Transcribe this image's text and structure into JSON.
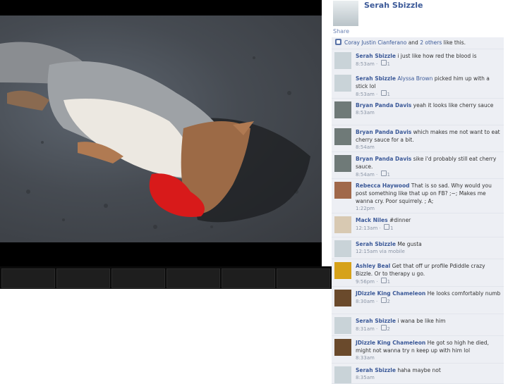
{
  "owner": {
    "name": "Serah Sbizzle",
    "share_label": "Share"
  },
  "likes": {
    "first": "Coray Justin Cianferano",
    "joiner": "and",
    "others": "2 others",
    "suffix": "like this."
  },
  "comments": [
    {
      "author": "Serah Sbizzle",
      "text": "i just like how red the blood is",
      "time": "8:53am",
      "likes": "1",
      "avatar": "#c9d3d8"
    },
    {
      "author": "Serah Sbizzle",
      "mention": "Alyssa Brown",
      "text": "picked him up with a stick lol",
      "time": "8:53am",
      "likes": "1",
      "avatar": "#c9d3d8"
    },
    {
      "author": "Bryan Panda Davis",
      "text": "yeah it looks like cherry sauce",
      "time": "8:53am",
      "likes": "",
      "avatar": "#6f7a78"
    },
    {
      "author": "Bryan Panda Davis",
      "text": "which makes me not want to eat cherry sauce for a bit.",
      "time": "8:54am",
      "likes": "",
      "avatar": "#6f7a78"
    },
    {
      "author": "Bryan Panda Davis",
      "text": "sike i'd probably still eat cherry sauce.",
      "time": "8:54am",
      "likes": "1",
      "avatar": "#6f7a78"
    },
    {
      "author": "Rebecca Haywood",
      "text": "That is so sad. Why would you post something like that up on FB? ;~; Makes me wanna cry. Poor squirrely. ; A;",
      "time": "1:22pm",
      "likes": "",
      "avatar": "#a0684a"
    },
    {
      "author": "Mack Niles",
      "text": "#dinner",
      "time": "12:13am",
      "likes": "1",
      "avatar": "#d8c9b2"
    },
    {
      "author": "Serah Sbizzle",
      "text": "Me gusta",
      "time": "12:15am",
      "via": "via mobile",
      "likes": "",
      "avatar": "#c9d3d8"
    },
    {
      "author": "Ashley Beal",
      "text": "Get that off ur profile Pdiddle crazy Bizzle. Or to therapy u go.",
      "time": "9:56pm",
      "likes": "1",
      "avatar": "#d6a21a"
    },
    {
      "author": "JDizzle King Chameleon",
      "text": "He looks comfortably numb",
      "time": "8:30am",
      "likes": "2",
      "avatar": "#6a4a2c"
    },
    {
      "author": "Serah Sbizzle",
      "text": "i wana be like him",
      "time": "8:31am",
      "likes": "2",
      "avatar": "#c9d3d8"
    },
    {
      "author": "JDizzle King Chameleon",
      "text": "He got so high he died, might not wanna try n keep up with him lol",
      "time": "8:33am",
      "likes": "",
      "avatar": "#6a4a2c"
    },
    {
      "author": "Serah Sbizzle",
      "text": "haha maybe not",
      "time": "8:35am",
      "likes": "",
      "avatar": "#c9d3d8"
    }
  ]
}
